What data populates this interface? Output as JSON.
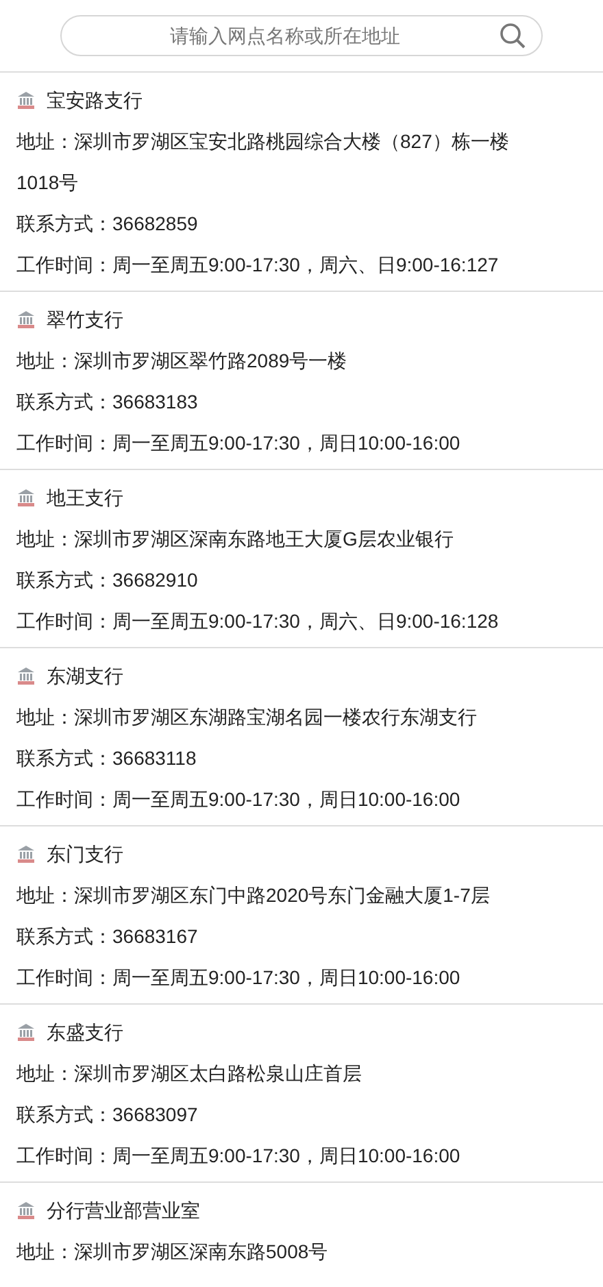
{
  "search": {
    "placeholder": "请输入网点名称或所在地址"
  },
  "branches": [
    {
      "name": "宝安路支行",
      "address": "地址：深圳市罗湖区宝安北路桃园综合大楼（827）栋一楼1018号",
      "phone": "联系方式：36682859",
      "hours": "工作时间：周一至周五9:00-17:30，周六、日9:00-16:127"
    },
    {
      "name": "翠竹支行",
      "address": "地址：深圳市罗湖区翠竹路2089号一楼",
      "phone": "联系方式：36683183",
      "hours": "工作时间：周一至周五9:00-17:30，周日10:00-16:00"
    },
    {
      "name": "地王支行",
      "address": "地址：深圳市罗湖区深南东路地王大厦G层农业银行",
      "phone": "联系方式：36682910",
      "hours": "工作时间：周一至周五9:00-17:30，周六、日9:00-16:128"
    },
    {
      "name": "东湖支行",
      "address": "地址：深圳市罗湖区东湖路宝湖名园一楼农行东湖支行",
      "phone": "联系方式：36683118",
      "hours": "工作时间：周一至周五9:00-17:30，周日10:00-16:00"
    },
    {
      "name": "东门支行",
      "address": "地址：深圳市罗湖区东门中路2020号东门金融大厦1-7层",
      "phone": "联系方式：36683167",
      "hours": "工作时间：周一至周五9:00-17:30，周日10:00-16:00"
    },
    {
      "name": "东盛支行",
      "address": "地址：深圳市罗湖区太白路松泉山庄首层",
      "phone": "联系方式：36683097",
      "hours": "工作时间：周一至周五9:00-17:30，周日10:00-16:00"
    },
    {
      "name": "分行营业部营业室",
      "address": "地址：深圳市罗湖区深南东路5008号"
    }
  ]
}
